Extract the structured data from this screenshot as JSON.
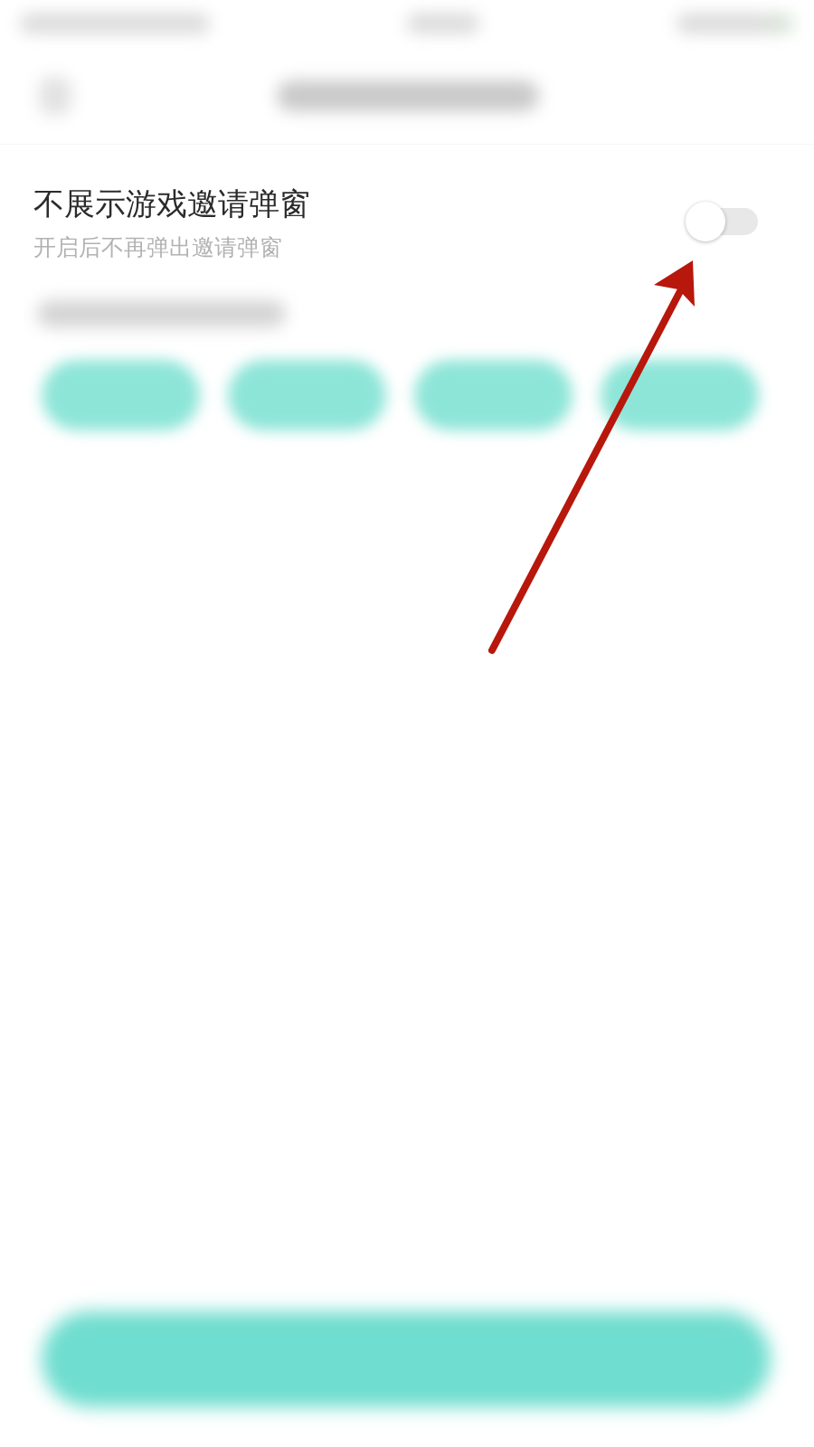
{
  "setting": {
    "title": "不展示游戏邀请弹窗",
    "description": "开启后不再弹出邀请弹窗",
    "on": false
  }
}
